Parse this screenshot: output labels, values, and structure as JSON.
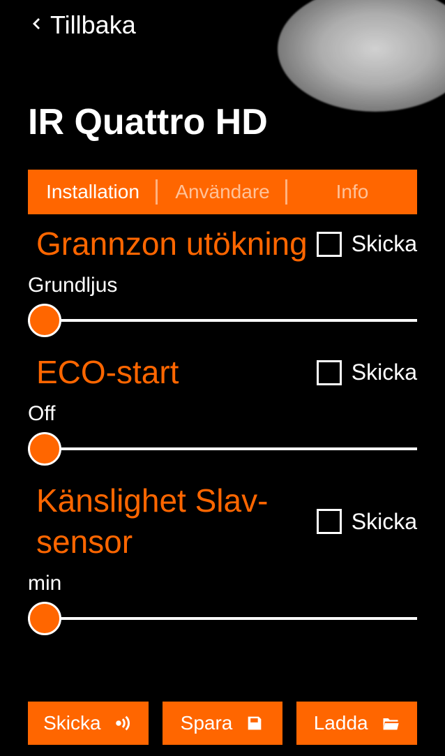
{
  "header": {
    "back_label": "Tillbaka",
    "title": "IR Quattro HD"
  },
  "tabs": [
    {
      "label": "Installation",
      "active": true
    },
    {
      "label": "Användare",
      "active": false
    },
    {
      "label": "Info",
      "active": false
    }
  ],
  "settings": [
    {
      "title": "Grannzon utökning",
      "checkbox_label": "Skicka",
      "slider_label": "Grundljus",
      "slider_value": 0
    },
    {
      "title": "ECO-start",
      "checkbox_label": "Skicka",
      "slider_label": "Off",
      "slider_value": 0
    },
    {
      "title": "Känslighet Slav-sensor",
      "checkbox_label": "Skicka",
      "slider_label": "min",
      "slider_value": 0
    }
  ],
  "actions": {
    "send_label": "Skicka",
    "save_label": "Spara",
    "load_label": "Ladda"
  },
  "colors": {
    "accent": "#ff6600",
    "background": "#000000",
    "text": "#ffffff"
  }
}
